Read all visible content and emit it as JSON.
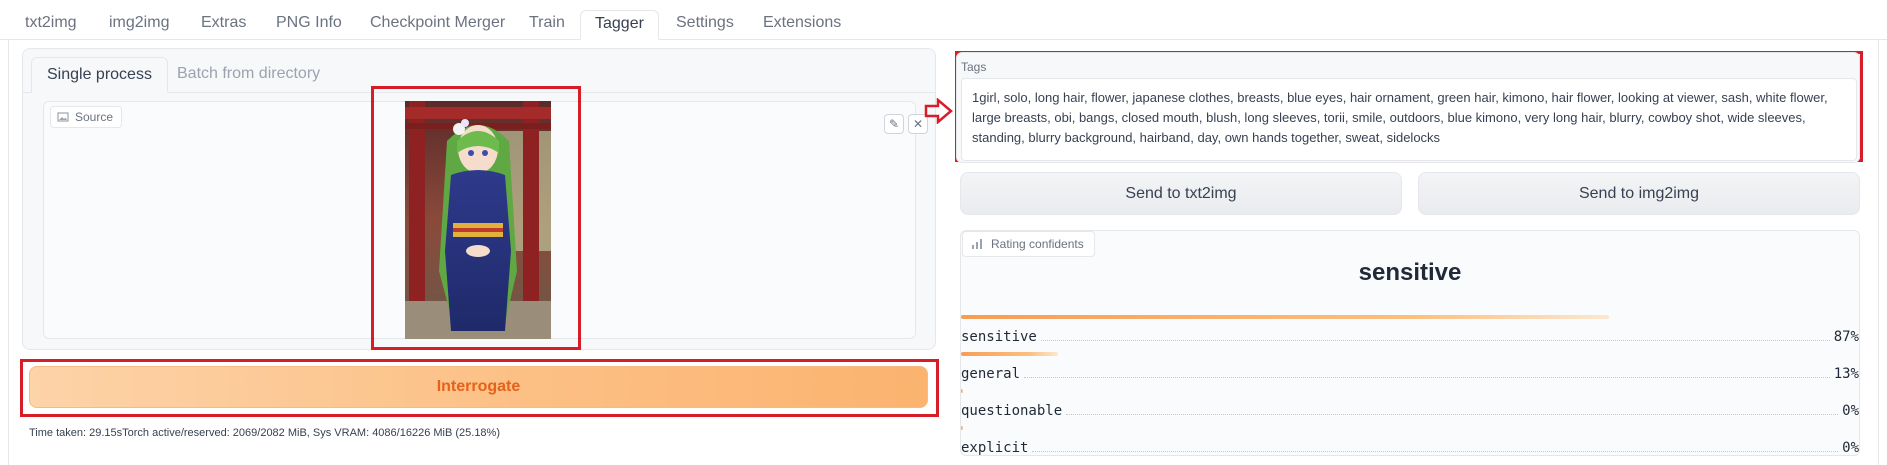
{
  "top_tabs": [
    {
      "label": "txt2img"
    },
    {
      "label": "img2img"
    },
    {
      "label": "Extras"
    },
    {
      "label": "PNG Info"
    },
    {
      "label": "Checkpoint Merger"
    },
    {
      "label": "Train"
    },
    {
      "label": "Tagger"
    },
    {
      "label": "Settings"
    },
    {
      "label": "Extensions"
    }
  ],
  "active_top_tab": "Tagger",
  "sub_tabs": [
    {
      "label": "Single process"
    },
    {
      "label": "Batch from directory"
    }
  ],
  "source": {
    "label": "Source",
    "image_desc": "anime girl with long green hair in blue kimono standing before red torii gate"
  },
  "interrogate_button": "Interrogate",
  "time_text": "Time taken: 29.15sTorch active/reserved: 2069/2082 MiB, Sys VRAM: 4086/16226 MiB (25.18%)",
  "tags": {
    "label": "Tags",
    "text": "1girl, solo, long hair, flower, japanese clothes, breasts, blue eyes, hair ornament, green hair, kimono, hair flower, looking at viewer, sash, white flower, large breasts, obi, bangs, closed mouth, blush, long sleeves, torii, smile, outdoors, blue kimono, very long hair, blurry, cowboy shot, wide sleeves, standing, blurry background, hairband, day, own hands together, sweat, sidelocks"
  },
  "send_buttons": {
    "txt2img": "Send to txt2img",
    "img2img": "Send to img2img"
  },
  "rating": {
    "label": "Rating confidents",
    "top": "sensitive",
    "items": [
      {
        "name": "sensitive",
        "value": 0.87,
        "pct": "87%"
      },
      {
        "name": "general",
        "value": 0.13,
        "pct": "13%"
      },
      {
        "name": "questionable",
        "value": 0.0,
        "pct": "0%"
      },
      {
        "name": "explicit",
        "value": 0.0,
        "pct": "0%"
      }
    ]
  },
  "colors": {
    "highlight_frame": "#d71e28",
    "accent_orange": "#e4621b",
    "bar_orange": "#f59e55"
  }
}
